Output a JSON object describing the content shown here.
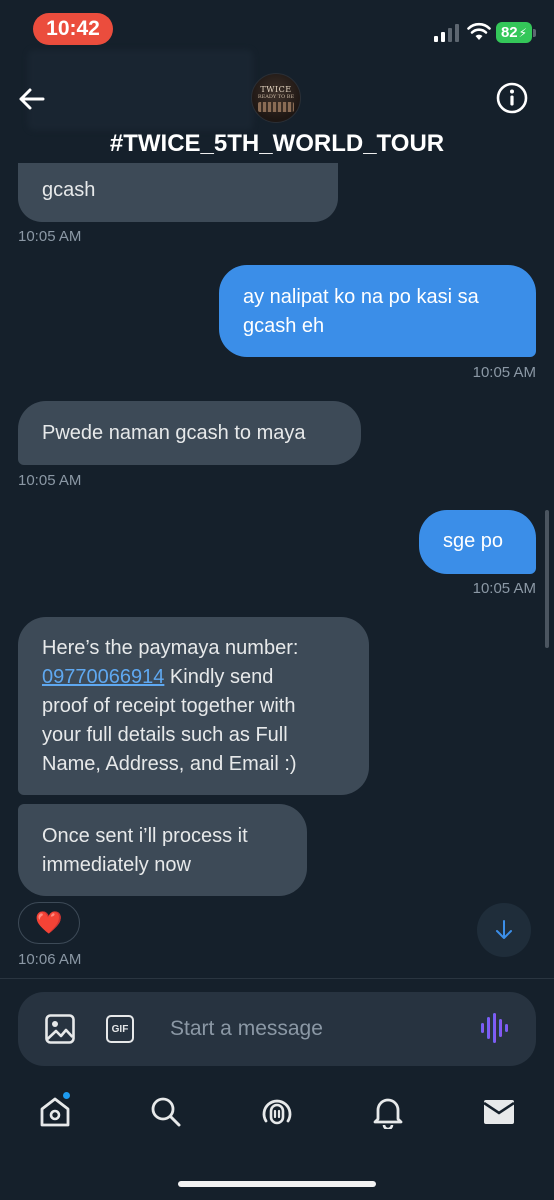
{
  "status_bar": {
    "time": "10:42",
    "battery": "82",
    "icons": [
      "cellular-signal-icon",
      "wifi-icon",
      "battery-charging-icon"
    ]
  },
  "header": {
    "title": "#TWICE_5TH_WORLD_TOUR",
    "avatar_text": [
      "TWICE",
      "READY TO BE"
    ],
    "back_icon": "arrow-left-icon",
    "info_icon": "info-circle-icon"
  },
  "messages": [
    {
      "direction": "received",
      "text": "gcash",
      "time": "10:05 AM"
    },
    {
      "direction": "sent",
      "lines": [
        "ay nalipat ko na po kasi sa",
        "gcash eh"
      ],
      "time": "10:05 AM"
    },
    {
      "direction": "received",
      "text": "Pwede naman gcash to maya",
      "time": "10:05 AM"
    },
    {
      "direction": "sent",
      "text": "sge po",
      "time": "10:05 AM"
    },
    {
      "direction": "received",
      "line1": "Here’s the paymaya number:",
      "link": "09770066914",
      "line2_rest": " Kindly send",
      "line3": "proof of receipt together with",
      "line4": "your full details such as Full",
      "line5": "Name, Address, and Email :)"
    },
    {
      "direction": "received",
      "lines": [
        "Once sent i’ll process it",
        "immediately now"
      ],
      "reaction": "❤️",
      "time": "10:06 AM"
    }
  ],
  "composer": {
    "placeholder": "Start a message",
    "gif_label": "GIF",
    "icons": [
      "image-icon",
      "gif-icon",
      "voice-waveform-icon"
    ]
  },
  "nav": {
    "items": [
      "home-icon",
      "search-icon",
      "spaces-icon",
      "notifications-bell-icon",
      "messages-envelope-icon"
    ],
    "home_has_notification": true
  },
  "colors": {
    "background": "#15202b",
    "sent_bubble": "#3b8ee8",
    "received_bubble": "#3d4a57",
    "accent_blue": "#1d9bf0",
    "time_pill": "#eb4d3d",
    "battery": "#34c759"
  }
}
